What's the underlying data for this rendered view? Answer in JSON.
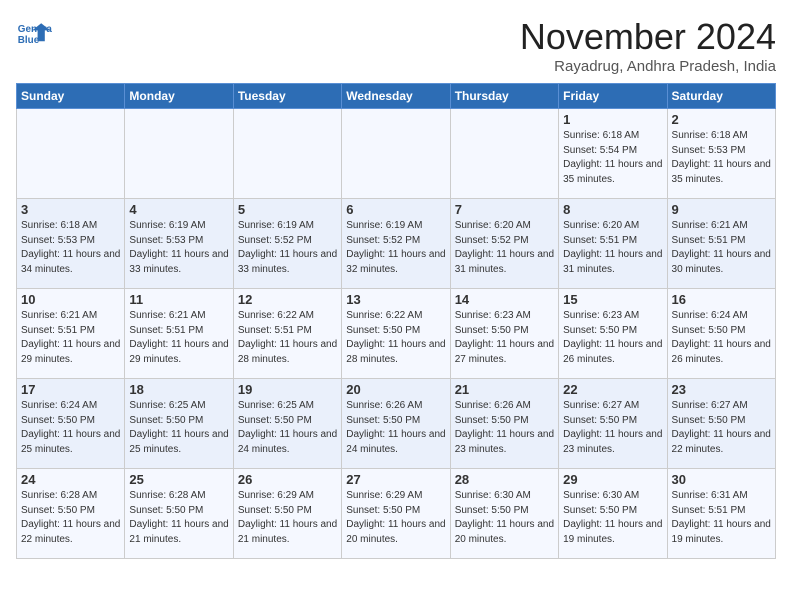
{
  "header": {
    "logo_line1": "General",
    "logo_line2": "Blue",
    "month_title": "November 2024",
    "location": "Rayadrug, Andhra Pradesh, India"
  },
  "weekdays": [
    "Sunday",
    "Monday",
    "Tuesday",
    "Wednesday",
    "Thursday",
    "Friday",
    "Saturday"
  ],
  "weeks": [
    [
      {
        "day": "",
        "info": ""
      },
      {
        "day": "",
        "info": ""
      },
      {
        "day": "",
        "info": ""
      },
      {
        "day": "",
        "info": ""
      },
      {
        "day": "",
        "info": ""
      },
      {
        "day": "1",
        "info": "Sunrise: 6:18 AM\nSunset: 5:54 PM\nDaylight: 11 hours and 35 minutes."
      },
      {
        "day": "2",
        "info": "Sunrise: 6:18 AM\nSunset: 5:53 PM\nDaylight: 11 hours and 35 minutes."
      }
    ],
    [
      {
        "day": "3",
        "info": "Sunrise: 6:18 AM\nSunset: 5:53 PM\nDaylight: 11 hours and 34 minutes."
      },
      {
        "day": "4",
        "info": "Sunrise: 6:19 AM\nSunset: 5:53 PM\nDaylight: 11 hours and 33 minutes."
      },
      {
        "day": "5",
        "info": "Sunrise: 6:19 AM\nSunset: 5:52 PM\nDaylight: 11 hours and 33 minutes."
      },
      {
        "day": "6",
        "info": "Sunrise: 6:19 AM\nSunset: 5:52 PM\nDaylight: 11 hours and 32 minutes."
      },
      {
        "day": "7",
        "info": "Sunrise: 6:20 AM\nSunset: 5:52 PM\nDaylight: 11 hours and 31 minutes."
      },
      {
        "day": "8",
        "info": "Sunrise: 6:20 AM\nSunset: 5:51 PM\nDaylight: 11 hours and 31 minutes."
      },
      {
        "day": "9",
        "info": "Sunrise: 6:21 AM\nSunset: 5:51 PM\nDaylight: 11 hours and 30 minutes."
      }
    ],
    [
      {
        "day": "10",
        "info": "Sunrise: 6:21 AM\nSunset: 5:51 PM\nDaylight: 11 hours and 29 minutes."
      },
      {
        "day": "11",
        "info": "Sunrise: 6:21 AM\nSunset: 5:51 PM\nDaylight: 11 hours and 29 minutes."
      },
      {
        "day": "12",
        "info": "Sunrise: 6:22 AM\nSunset: 5:51 PM\nDaylight: 11 hours and 28 minutes."
      },
      {
        "day": "13",
        "info": "Sunrise: 6:22 AM\nSunset: 5:50 PM\nDaylight: 11 hours and 28 minutes."
      },
      {
        "day": "14",
        "info": "Sunrise: 6:23 AM\nSunset: 5:50 PM\nDaylight: 11 hours and 27 minutes."
      },
      {
        "day": "15",
        "info": "Sunrise: 6:23 AM\nSunset: 5:50 PM\nDaylight: 11 hours and 26 minutes."
      },
      {
        "day": "16",
        "info": "Sunrise: 6:24 AM\nSunset: 5:50 PM\nDaylight: 11 hours and 26 minutes."
      }
    ],
    [
      {
        "day": "17",
        "info": "Sunrise: 6:24 AM\nSunset: 5:50 PM\nDaylight: 11 hours and 25 minutes."
      },
      {
        "day": "18",
        "info": "Sunrise: 6:25 AM\nSunset: 5:50 PM\nDaylight: 11 hours and 25 minutes."
      },
      {
        "day": "19",
        "info": "Sunrise: 6:25 AM\nSunset: 5:50 PM\nDaylight: 11 hours and 24 minutes."
      },
      {
        "day": "20",
        "info": "Sunrise: 6:26 AM\nSunset: 5:50 PM\nDaylight: 11 hours and 24 minutes."
      },
      {
        "day": "21",
        "info": "Sunrise: 6:26 AM\nSunset: 5:50 PM\nDaylight: 11 hours and 23 minutes."
      },
      {
        "day": "22",
        "info": "Sunrise: 6:27 AM\nSunset: 5:50 PM\nDaylight: 11 hours and 23 minutes."
      },
      {
        "day": "23",
        "info": "Sunrise: 6:27 AM\nSunset: 5:50 PM\nDaylight: 11 hours and 22 minutes."
      }
    ],
    [
      {
        "day": "24",
        "info": "Sunrise: 6:28 AM\nSunset: 5:50 PM\nDaylight: 11 hours and 22 minutes."
      },
      {
        "day": "25",
        "info": "Sunrise: 6:28 AM\nSunset: 5:50 PM\nDaylight: 11 hours and 21 minutes."
      },
      {
        "day": "26",
        "info": "Sunrise: 6:29 AM\nSunset: 5:50 PM\nDaylight: 11 hours and 21 minutes."
      },
      {
        "day": "27",
        "info": "Sunrise: 6:29 AM\nSunset: 5:50 PM\nDaylight: 11 hours and 20 minutes."
      },
      {
        "day": "28",
        "info": "Sunrise: 6:30 AM\nSunset: 5:50 PM\nDaylight: 11 hours and 20 minutes."
      },
      {
        "day": "29",
        "info": "Sunrise: 6:30 AM\nSunset: 5:50 PM\nDaylight: 11 hours and 19 minutes."
      },
      {
        "day": "30",
        "info": "Sunrise: 6:31 AM\nSunset: 5:51 PM\nDaylight: 11 hours and 19 minutes."
      }
    ]
  ]
}
